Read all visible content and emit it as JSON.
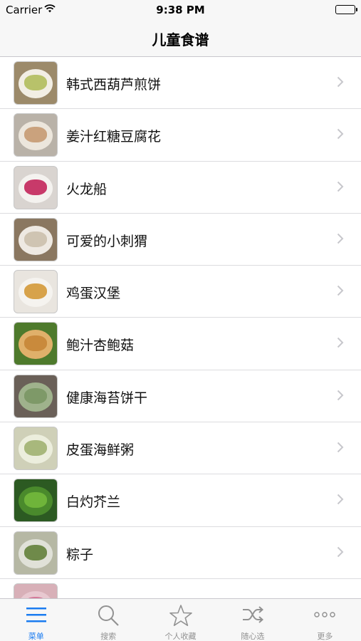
{
  "status_bar": {
    "carrier": "Carrier",
    "time": "9:38 PM"
  },
  "nav": {
    "title": "儿童食谱"
  },
  "recipes": [
    {
      "label": "韩式西葫芦煎饼",
      "bg": "#9c8a6a",
      "plate": "#f2eee4",
      "food": "#b8c26a"
    },
    {
      "label": "姜汁红糖豆腐花",
      "bg": "#b9b2a8",
      "plate": "#ece6dc",
      "food": "#caa27d"
    },
    {
      "label": "火龙船",
      "bg": "#d9d4d0",
      "plate": "#f4f2ef",
      "food": "#c83a6a"
    },
    {
      "label": "可爱的小刺猬",
      "bg": "#8a7760",
      "plate": "#eee9e2",
      "food": "#cfc4b2"
    },
    {
      "label": "鸡蛋汉堡",
      "bg": "#e9e5df",
      "plate": "#f5f3ef",
      "food": "#d7a24a"
    },
    {
      "label": "鲍汁杏鲍菇",
      "bg": "#4e7a2c",
      "plate": "#e0b06a",
      "food": "#c98a3c"
    },
    {
      "label": "健康海苔饼干",
      "bg": "#6a6058",
      "plate": "#9fb28c",
      "food": "#7e9968"
    },
    {
      "label": "皮蛋海鲜粥",
      "bg": "#cfd0b8",
      "plate": "#eceedd",
      "food": "#a8b87c"
    },
    {
      "label": "白灼芥兰",
      "bg": "#2c5a22",
      "plate": "#4a8a2c",
      "food": "#6fb43a"
    },
    {
      "label": "粽子",
      "bg": "#b6b8a4",
      "plate": "#e0e1d8",
      "food": "#6f8a4a"
    },
    {
      "label": "",
      "bg": "#d8b0b8",
      "plate": "#e8c8d0",
      "food": "#d47a9a"
    }
  ],
  "tabs": [
    {
      "label": "菜单",
      "icon": "menu-icon",
      "active": true
    },
    {
      "label": "搜索",
      "icon": "search-icon",
      "active": false
    },
    {
      "label": "个人收藏",
      "icon": "star-icon",
      "active": false
    },
    {
      "label": "随心选",
      "icon": "shuffle-icon",
      "active": false
    },
    {
      "label": "更多",
      "icon": "more-icon",
      "active": false
    }
  ],
  "colors": {
    "accent": "#1b7cf0",
    "inactive": "#929292",
    "chevron": "#c7c7cc"
  }
}
